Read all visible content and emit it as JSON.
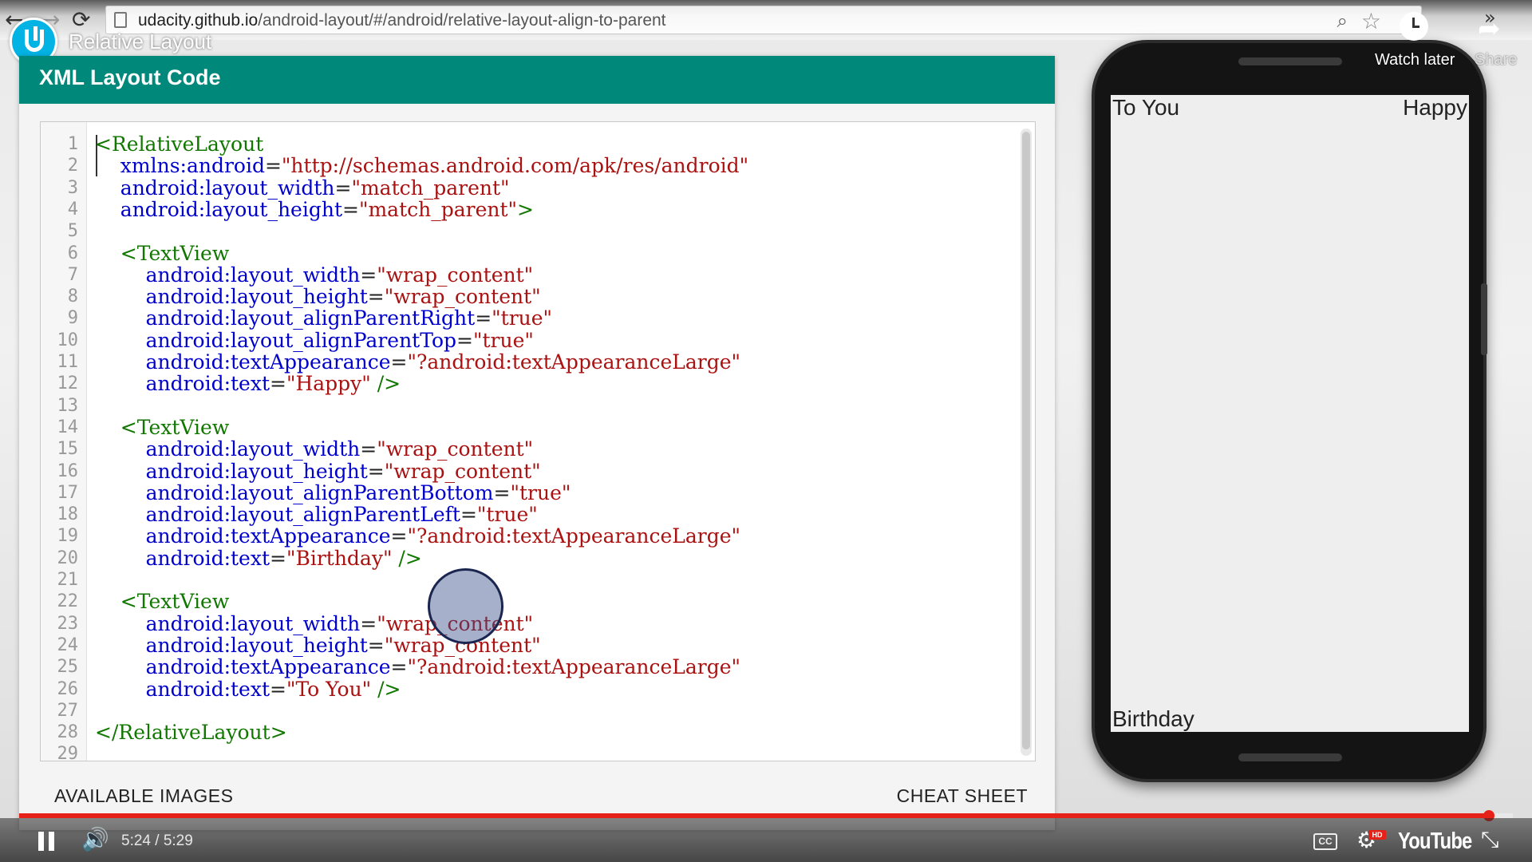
{
  "browser": {
    "url_host": "udacity.github.io",
    "url_path": "/android-layout/#/android/relative-layout-align-to-parent"
  },
  "video": {
    "title": "Relative Layout",
    "watch_later_label": "Watch later",
    "share_label": "Share",
    "time_display": "5:24 / 5:29",
    "progress": 0.984,
    "brand": "YouTube",
    "cc_label": "CC",
    "hd_label": "HD"
  },
  "panel": {
    "title": "XML Layout Code",
    "available_images_label": "AVAILABLE IMAGES",
    "cheat_sheet_label": "CHEAT SHEET"
  },
  "code": {
    "line_numbers": [
      "1",
      "2",
      "3",
      "4",
      "5",
      "6",
      "7",
      "8",
      "9",
      "10",
      "11",
      "12",
      "13",
      "14",
      "15",
      "16",
      "17",
      "18",
      "19",
      "20",
      "21",
      "22",
      "23",
      "24",
      "25",
      "26",
      "27",
      "28",
      "29"
    ],
    "lines": [
      "<RelativeLayout",
      "    xmlns:android=\"http://schemas.android.com/apk/res/android\"",
      "    android:layout_width=\"match_parent\"",
      "    android:layout_height=\"match_parent\">",
      "",
      "    <TextView",
      "        android:layout_width=\"wrap_content\"",
      "        android:layout_height=\"wrap_content\"",
      "        android:layout_alignParentRight=\"true\"",
      "        android:layout_alignParentTop=\"true\"",
      "        android:textAppearance=\"?android:textAppearanceLarge\"",
      "        android:text=\"Happy\" />",
      "",
      "    <TextView",
      "        android:layout_width=\"wrap_content\"",
      "        android:layout_height=\"wrap_content\"",
      "        android:layout_alignParentBottom=\"true\"",
      "        android:layout_alignParentLeft=\"true\"",
      "        android:textAppearance=\"?android:textAppearanceLarge\"",
      "        android:text=\"Birthday\" />",
      "",
      "    <TextView",
      "        android:layout_width=\"wrap_content\"",
      "        android:layout_height=\"wrap_content\"",
      "        android:textAppearance=\"?android:textAppearanceLarge\"",
      "        android:text=\"To You\" />",
      "",
      "</RelativeLayout>",
      ""
    ]
  },
  "phone": {
    "top_left_text": "To You",
    "top_right_text": "Happy",
    "bottom_left_text": "Birthday"
  },
  "colors": {
    "header_teal": "#00897b",
    "progress_red": "#e62117",
    "udacity_blue": "#02b3e4"
  }
}
